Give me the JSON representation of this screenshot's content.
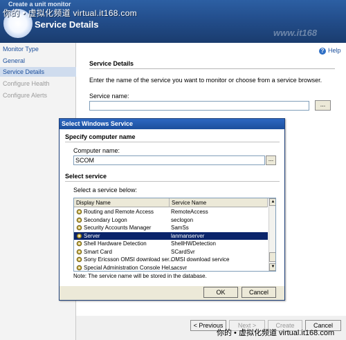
{
  "window": {
    "title": "Create a unit monitor",
    "header_title": "Service Details",
    "watermark_top": "你的 • 虚拟化频道 virtual.it168.com",
    "watermark_bottom": "你的 • 虚拟化频道 virtual.it168.com",
    "logo": "www.it168"
  },
  "nav": {
    "items": [
      {
        "label": "Monitor Type",
        "state": "link"
      },
      {
        "label": "General",
        "state": "link"
      },
      {
        "label": "Service Details",
        "state": "active"
      },
      {
        "label": "Configure Health",
        "state": "dim"
      },
      {
        "label": "Configure Alerts",
        "state": "dim"
      }
    ]
  },
  "main": {
    "help_label": "Help",
    "section_title": "Service Details",
    "instructions": "Enter the name of the service you want to monitor or choose from a service browser.",
    "service_name_label": "Service name:",
    "service_name_value": "",
    "browse_label": "..."
  },
  "dialog": {
    "title": "Select Windows Service",
    "specify_heading": "Specify computer name",
    "computer_label": "Computer name:",
    "computer_value": "SCOM",
    "browse_label": "...",
    "select_heading": "Select service",
    "select_label": "Select a service below:",
    "columns": [
      "Display Name",
      "Service Name"
    ],
    "rows": [
      {
        "display": "Routing and Remote Access",
        "service": "RemoteAccess",
        "selected": false
      },
      {
        "display": "Secondary Logon",
        "service": "seclogon",
        "selected": false
      },
      {
        "display": "Security Accounts Manager",
        "service": "SamSs",
        "selected": false
      },
      {
        "display": "Server",
        "service": "lanmanserver",
        "selected": true
      },
      {
        "display": "Shell Hardware Detection",
        "service": "ShellHWDetection",
        "selected": false
      },
      {
        "display": "Smart Card",
        "service": "SCardSvr",
        "selected": false
      },
      {
        "display": "Sony Ericsson OMSI download ser...",
        "service": "OMSI download service",
        "selected": false
      },
      {
        "display": "Special Administration Console Hel...",
        "service": "sacsvr",
        "selected": false
      }
    ],
    "note": "Note: The service name will be stored in the database.",
    "ok_label": "OK",
    "cancel_label": "Cancel"
  },
  "wizard_buttons": {
    "previous": "< Previous",
    "next": "Next >",
    "create": "Create",
    "cancel": "Cancel"
  },
  "colors": {
    "header": "#234e8c",
    "selection": "#0a246a",
    "link": "#1c4f9c"
  }
}
